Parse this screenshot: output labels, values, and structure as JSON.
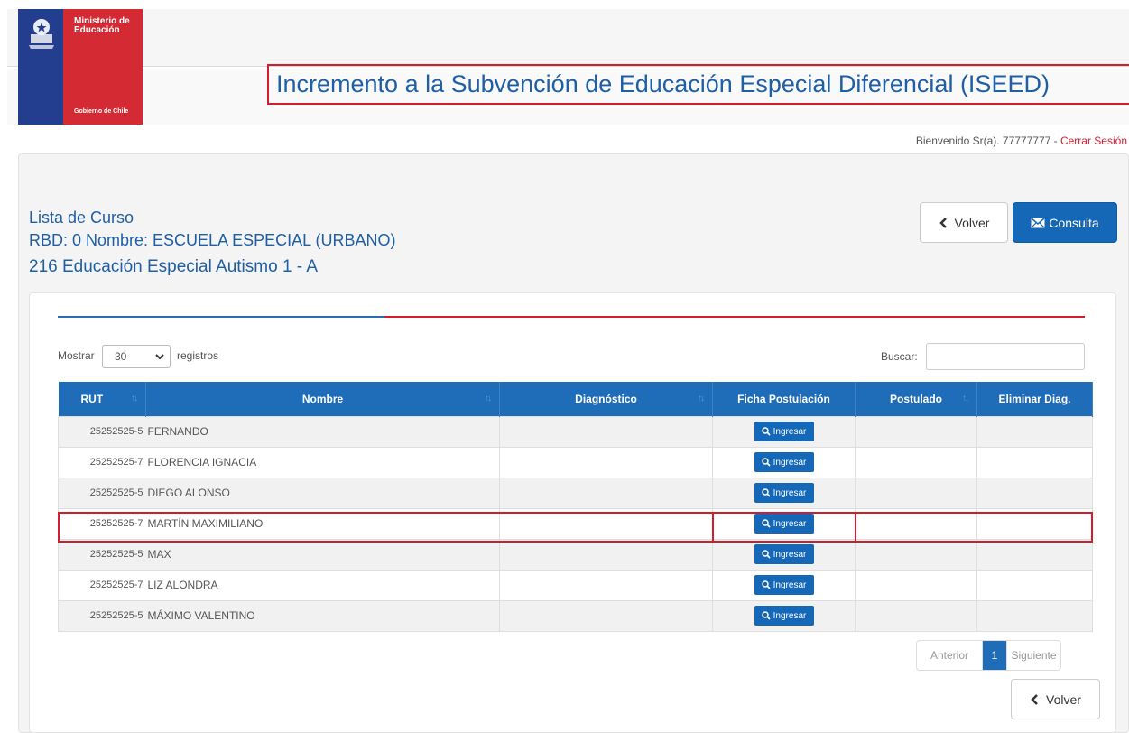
{
  "header": {
    "logo": {
      "ministry": "Ministerio de Educación",
      "government": "Gobierno de Chile"
    },
    "title": "Incremento a la Subvención de Educación Especial Diferencial (ISEED)",
    "welcome_prefix": "Bienvenido Sr(a). 77777777 - ",
    "logout_label": "Cerrar Sesión"
  },
  "course": {
    "title": "Lista de Curso",
    "line2": "RBD: 0 Nombre: ESCUELA ESPECIAL (URBANO)",
    "line3": "216 Educación Especial Autismo 1 - A"
  },
  "actions": {
    "volver_label": "Volver",
    "consulta_label": "Consulta"
  },
  "table_controls": {
    "show_label": "Mostrar",
    "page_size": "30",
    "records_label": "registros",
    "search_label": "Buscar:"
  },
  "table": {
    "columns": [
      "RUT",
      "Nombre",
      "Diagnóstico",
      "Ficha Postulación",
      "Postulado",
      "Eliminar Diag."
    ],
    "ingresar_label": "Ingresar",
    "rows": [
      {
        "rut": "25252525-5",
        "nombre": "FERNANDO",
        "diagnostico": "",
        "postulado": "",
        "eliminar": ""
      },
      {
        "rut": "25252525-7",
        "nombre": "FLORENCIA IGNACIA",
        "diagnostico": "",
        "postulado": "",
        "eliminar": ""
      },
      {
        "rut": "25252525-5",
        "nombre": "DIEGO ALONSO",
        "diagnostico": "",
        "postulado": "",
        "eliminar": ""
      },
      {
        "rut": "25252525-7",
        "nombre": "MARTÍN MAXIMILIANO",
        "diagnostico": "",
        "postulado": "",
        "eliminar": ""
      },
      {
        "rut": "25252525-5",
        "nombre": "MAX",
        "diagnostico": "",
        "postulado": "",
        "eliminar": ""
      },
      {
        "rut": "25252525-7",
        "nombre": "LIZ ALONDRA",
        "diagnostico": "",
        "postulado": "",
        "eliminar": ""
      },
      {
        "rut": "25252525-5",
        "nombre": "MÁXIMO VALENTINO",
        "diagnostico": "",
        "postulado": "",
        "eliminar": ""
      }
    ]
  },
  "pagination": {
    "previous": "Anterior",
    "current": "1",
    "next": "Siguiente"
  },
  "colors": {
    "primary_blue": "#1468b7",
    "title_blue": "#1f5fa6",
    "highlight_red": "#d11d2d"
  },
  "icons": {
    "volver": "chevron-left-icon",
    "consulta": "envelope-icon",
    "ingresar": "search-icon",
    "sort": "sort-icon"
  }
}
